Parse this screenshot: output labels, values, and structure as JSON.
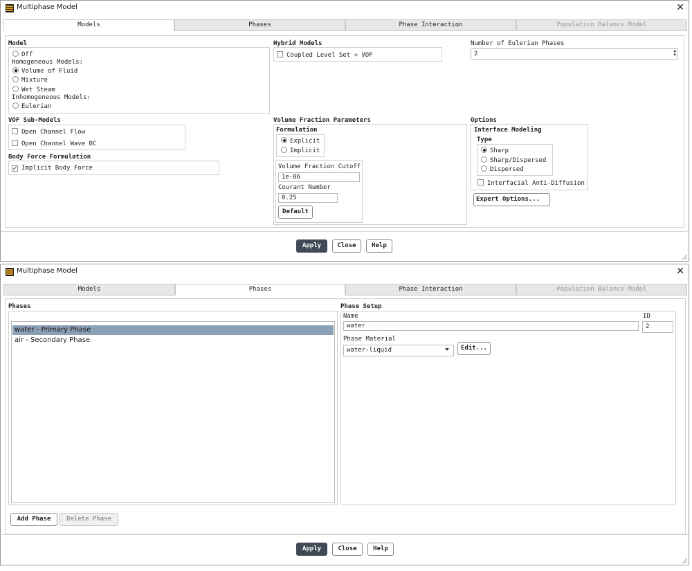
{
  "window_title": "Multiphase Model",
  "tabs": [
    "Models",
    "Phases",
    "Phase Interaction",
    "Population Balance Model"
  ],
  "dialog1": {
    "model": {
      "heading": "Model",
      "off": "Off",
      "homogeneous_heading": "Homogeneous Models:",
      "vof": "Volume of Fluid",
      "mixture": "Mixture",
      "wet_steam": "Wet Steam",
      "inhomogeneous_heading": "Inhomogeneous Models:",
      "eulerian": "Eulerian",
      "selected": "Volume of Fluid"
    },
    "hybrid": {
      "heading": "Hybrid Models",
      "coupled_level_set": "Coupled Level Set + VOF",
      "coupled_checked": false
    },
    "eulerian_phases": {
      "label": "Number of Eulerian Phases",
      "value": "2"
    },
    "vof_submodels": {
      "heading": "VOF Sub-Models",
      "open_channel_flow": "Open Channel Flow",
      "open_channel_wave_bc": "Open Channel Wave BC"
    },
    "body_force": {
      "heading": "Body Force Formulation",
      "implicit_body_force": "Implicit Body Force",
      "checked": true
    },
    "vfp": {
      "heading": "Volume Fraction Parameters",
      "formulation": "Formulation",
      "explicit": "Explicit",
      "implicit": "Implicit",
      "selected": "Explicit",
      "cutoff_label": "Volume Fraction Cutoff",
      "cutoff_value": "1e-06",
      "courant_label": "Courant Number",
      "courant_value": "0.25",
      "default_button": "Default"
    },
    "options": {
      "heading": "Options",
      "interface_modeling": "Interface Modeling",
      "type": "Type",
      "sharp": "Sharp",
      "sharp_dispersed": "Sharp/Dispersed",
      "dispersed": "Dispersed",
      "selected": "Sharp",
      "anti_diffusion": "Interfacial Anti-Diffusion",
      "expert_button": "Expert Options..."
    }
  },
  "dialog2": {
    "phases_heading": "Phases",
    "phase_list": [
      "water - Primary Phase",
      "air - Secondary Phase"
    ],
    "selected_phase": "water - Primary Phase",
    "setup": {
      "heading": "Phase Setup",
      "name_label": "Name",
      "name_value": "water",
      "id_label": "ID",
      "id_value": "2",
      "material_label": "Phase Material",
      "material_value": "water-liquid",
      "edit_button": "Edit..."
    },
    "add_phase": "Add Phase",
    "delete_phase": "Delete Phase"
  },
  "buttons": {
    "apply": "Apply",
    "close": "Close",
    "help": "Help"
  },
  "colors": {
    "apply_bg": "#3f4a56",
    "list_selection": "#8ca0b5"
  }
}
